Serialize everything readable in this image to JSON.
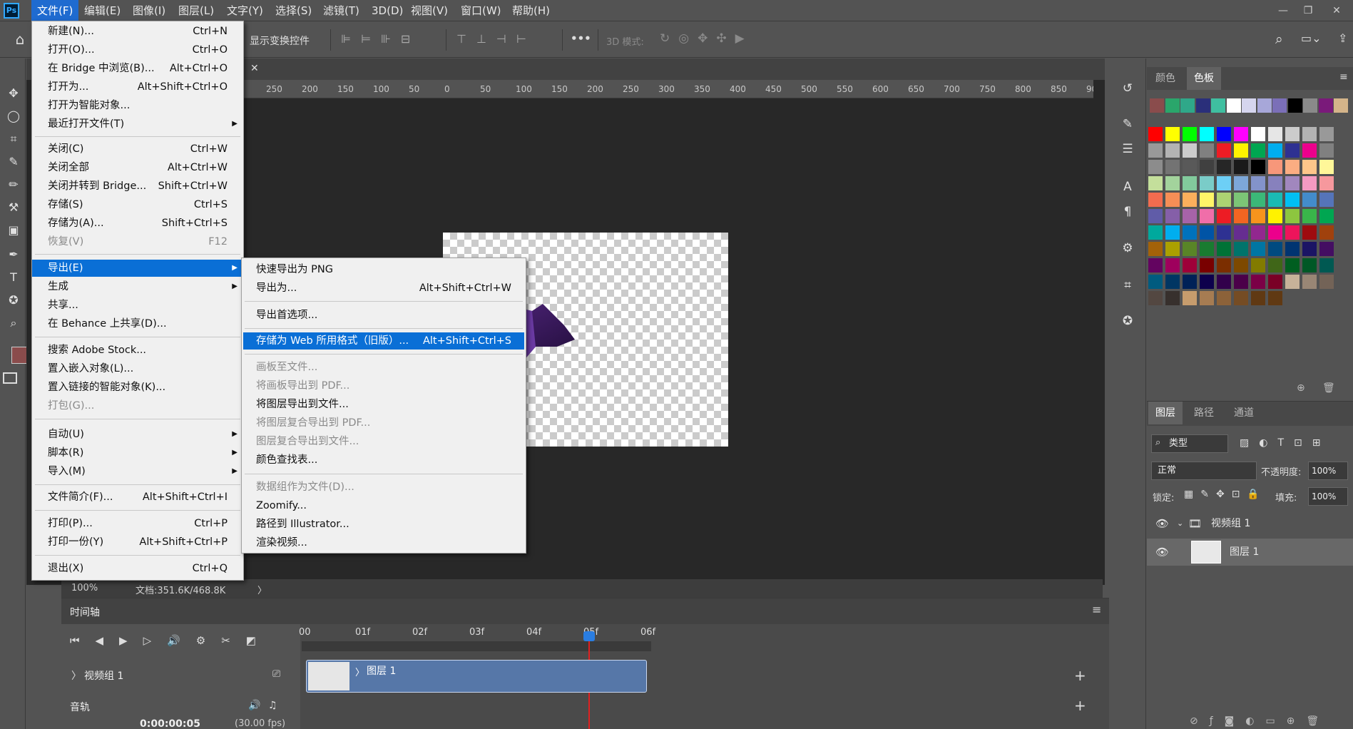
{
  "app": {
    "logo": "Ps"
  },
  "menubar": {
    "items": [
      "文件(F)",
      "编辑(E)",
      "图像(I)",
      "图层(L)",
      "文字(Y)",
      "选择(S)",
      "滤镜(T)",
      "3D(D)",
      "视图(V)",
      "窗口(W)",
      "帮助(H)"
    ]
  },
  "optionsbar": {
    "show_transform": "显示变换控件",
    "mode_3d": "3D 模式:",
    "more": "•••"
  },
  "ruler": {
    "ticks": [
      "250",
      "200",
      "150",
      "100",
      "50",
      "0",
      "50",
      "100",
      "150",
      "200",
      "250",
      "300",
      "350",
      "400",
      "450",
      "500",
      "550",
      "600",
      "650",
      "700",
      "750",
      "800",
      "850",
      "90"
    ]
  },
  "status": {
    "zoom": "100%",
    "doc": "文档:351.6K/468.8K",
    "arrow": "〉"
  },
  "file_menu": {
    "items": [
      {
        "label": "新建(N)...",
        "shortcut": "Ctrl+N"
      },
      {
        "label": "打开(O)...",
        "shortcut": "Ctrl+O"
      },
      {
        "label": "在 Bridge 中浏览(B)...",
        "shortcut": "Alt+Ctrl+O"
      },
      {
        "label": "打开为...",
        "shortcut": "Alt+Shift+Ctrl+O"
      },
      {
        "label": "打开为智能对象...",
        "shortcut": ""
      },
      {
        "label": "最近打开文件(T)",
        "shortcut": ""
      },
      {
        "label": "关闭(C)",
        "shortcut": "Ctrl+W"
      },
      {
        "label": "关闭全部",
        "shortcut": "Alt+Ctrl+W"
      },
      {
        "label": "关闭并转到 Bridge...",
        "shortcut": "Shift+Ctrl+W"
      },
      {
        "label": "存储(S)",
        "shortcut": "Ctrl+S"
      },
      {
        "label": "存储为(A)...",
        "shortcut": "Shift+Ctrl+S"
      },
      {
        "label": "恢复(V)",
        "shortcut": "F12"
      },
      {
        "label": "导出(E)",
        "shortcut": ""
      },
      {
        "label": "生成",
        "shortcut": ""
      },
      {
        "label": "共享...",
        "shortcut": ""
      },
      {
        "label": "在 Behance 上共享(D)...",
        "shortcut": ""
      },
      {
        "label": "搜索 Adobe Stock...",
        "shortcut": ""
      },
      {
        "label": "置入嵌入对象(L)...",
        "shortcut": ""
      },
      {
        "label": "置入链接的智能对象(K)...",
        "shortcut": ""
      },
      {
        "label": "打包(G)...",
        "shortcut": ""
      },
      {
        "label": "自动(U)",
        "shortcut": ""
      },
      {
        "label": "脚本(R)",
        "shortcut": ""
      },
      {
        "label": "导入(M)",
        "shortcut": ""
      },
      {
        "label": "文件简介(F)...",
        "shortcut": "Alt+Shift+Ctrl+I"
      },
      {
        "label": "打印(P)...",
        "shortcut": "Ctrl+P"
      },
      {
        "label": "打印一份(Y)",
        "shortcut": "Alt+Shift+Ctrl+P"
      },
      {
        "label": "退出(X)",
        "shortcut": "Ctrl+Q"
      }
    ]
  },
  "export_menu": {
    "items": [
      {
        "label": "快速导出为 PNG",
        "shortcut": ""
      },
      {
        "label": "导出为...",
        "shortcut": "Alt+Shift+Ctrl+W"
      },
      {
        "label": "导出首选项...",
        "shortcut": ""
      },
      {
        "label": "存储为 Web 所用格式（旧版）...",
        "shortcut": "Alt+Shift+Ctrl+S"
      },
      {
        "label": "画板至文件...",
        "shortcut": ""
      },
      {
        "label": "将画板导出到 PDF...",
        "shortcut": ""
      },
      {
        "label": "将图层导出到文件...",
        "shortcut": ""
      },
      {
        "label": "将图层复合导出到 PDF...",
        "shortcut": ""
      },
      {
        "label": "图层复合导出到文件...",
        "shortcut": ""
      },
      {
        "label": "颜色查找表...",
        "shortcut": ""
      },
      {
        "label": "数据组作为文件(D)...",
        "shortcut": ""
      },
      {
        "label": "Zoomify...",
        "shortcut": ""
      },
      {
        "label": "路径到 Illustrator...",
        "shortcut": ""
      },
      {
        "label": "渲染视频...",
        "shortcut": ""
      }
    ]
  },
  "swatches_panel": {
    "tabs": [
      "颜色",
      "色板"
    ],
    "recent": [
      "#8a4c4c",
      "#2aa66b",
      "#2fa889",
      "#2a2f7a",
      "#3fbfa0",
      "#ffffff",
      "#d5d5ee",
      "#a7a7d9",
      "#7b6fb8",
      "#000000",
      "#8a8a8a",
      "#7a1a7a",
      "#d4b48a"
    ],
    "grid": [
      [
        "#ff0000",
        "#ffff00",
        "#00ff00",
        "#00ffff",
        "#0000ff",
        "#ff00ff",
        "#ffffff",
        "#e6e6e6",
        "#cccccc",
        "#b3b3b3",
        "#999999"
      ],
      [
        "#999999",
        "#b3b3b3",
        "#cccccc",
        "#808080",
        "#ed1c24",
        "#fff200",
        "#00a651",
        "#00aeef",
        "#2e3192",
        "#ec008c",
        "#808080"
      ],
      [
        "#8c8c8c",
        "#737373",
        "#595959",
        "#404040",
        "#262626",
        "#1a1a1a",
        "#000000",
        "#f7977a",
        "#fbad82",
        "#fdc68a",
        "#fff799"
      ],
      [
        "#c4df9b",
        "#a3d39c",
        "#82ca9c",
        "#7accc8",
        "#6dcff6",
        "#7da7d8",
        "#8393ca",
        "#8781bd",
        "#a187be",
        "#f49ac2",
        "#f6989d"
      ],
      [
        "#f26c4f",
        "#f68e56",
        "#fbaf5c",
        "#fff568",
        "#acd372",
        "#7cc576",
        "#3bb878",
        "#1abbb4",
        "#00bff3",
        "#438ccb",
        "#5574b9"
      ],
      [
        "#605ca8",
        "#855fa8",
        "#a763a8",
        "#f06ea9",
        "#ed1c24",
        "#f26522",
        "#f7941d",
        "#fff200",
        "#8dc63f",
        "#39b54a",
        "#00a651"
      ],
      [
        "#00a99d",
        "#00aeef",
        "#0072bc",
        "#0054a6",
        "#2e3192",
        "#662d91",
        "#92278f",
        "#ec008c",
        "#ed145b",
        "#9e0b0f",
        "#a0410d"
      ],
      [
        "#a36209",
        "#aba000",
        "#598527",
        "#197b30",
        "#007236",
        "#00746b",
        "#0076a3",
        "#004a80",
        "#003471",
        "#1b1464",
        "#440e62"
      ],
      [
        "#630460",
        "#9e005d",
        "#9e0039",
        "#790000",
        "#7b2e00",
        "#7d4900",
        "#827b00",
        "#406618",
        "#005e20",
        "#005826",
        "#005952"
      ],
      [
        "#005b7f",
        "#003663",
        "#002157",
        "#0d004c",
        "#32004b",
        "#4b0049",
        "#7b0046",
        "#7a0026",
        "#c7b299",
        "#998675",
        "#736357"
      ],
      [
        "#534741",
        "#37302d",
        "#c69c6d",
        "#a67c52",
        "#8c6239",
        "#754c24",
        "#603913",
        "#603913",
        "",
        "",
        ""
      ]
    ]
  },
  "layers_panel": {
    "tabs": [
      "图层",
      "路径",
      "通道"
    ],
    "filter": "类型",
    "blend": "正常",
    "opacity_label": "不透明度:",
    "opacity": "100%",
    "lock_label": "锁定:",
    "fill_label": "填充:",
    "fill": "100%",
    "group": "视频组 1",
    "layer": "图层 1"
  },
  "timeline": {
    "title": "时间轴",
    "frames": [
      "00",
      "01f",
      "02f",
      "03f",
      "04f",
      "05f",
      "06f"
    ],
    "track": "视频组 1",
    "audio": "音轨",
    "clip": "图层 1",
    "timecode": "0:00:00:05",
    "fps": "(30.00 fps)"
  }
}
